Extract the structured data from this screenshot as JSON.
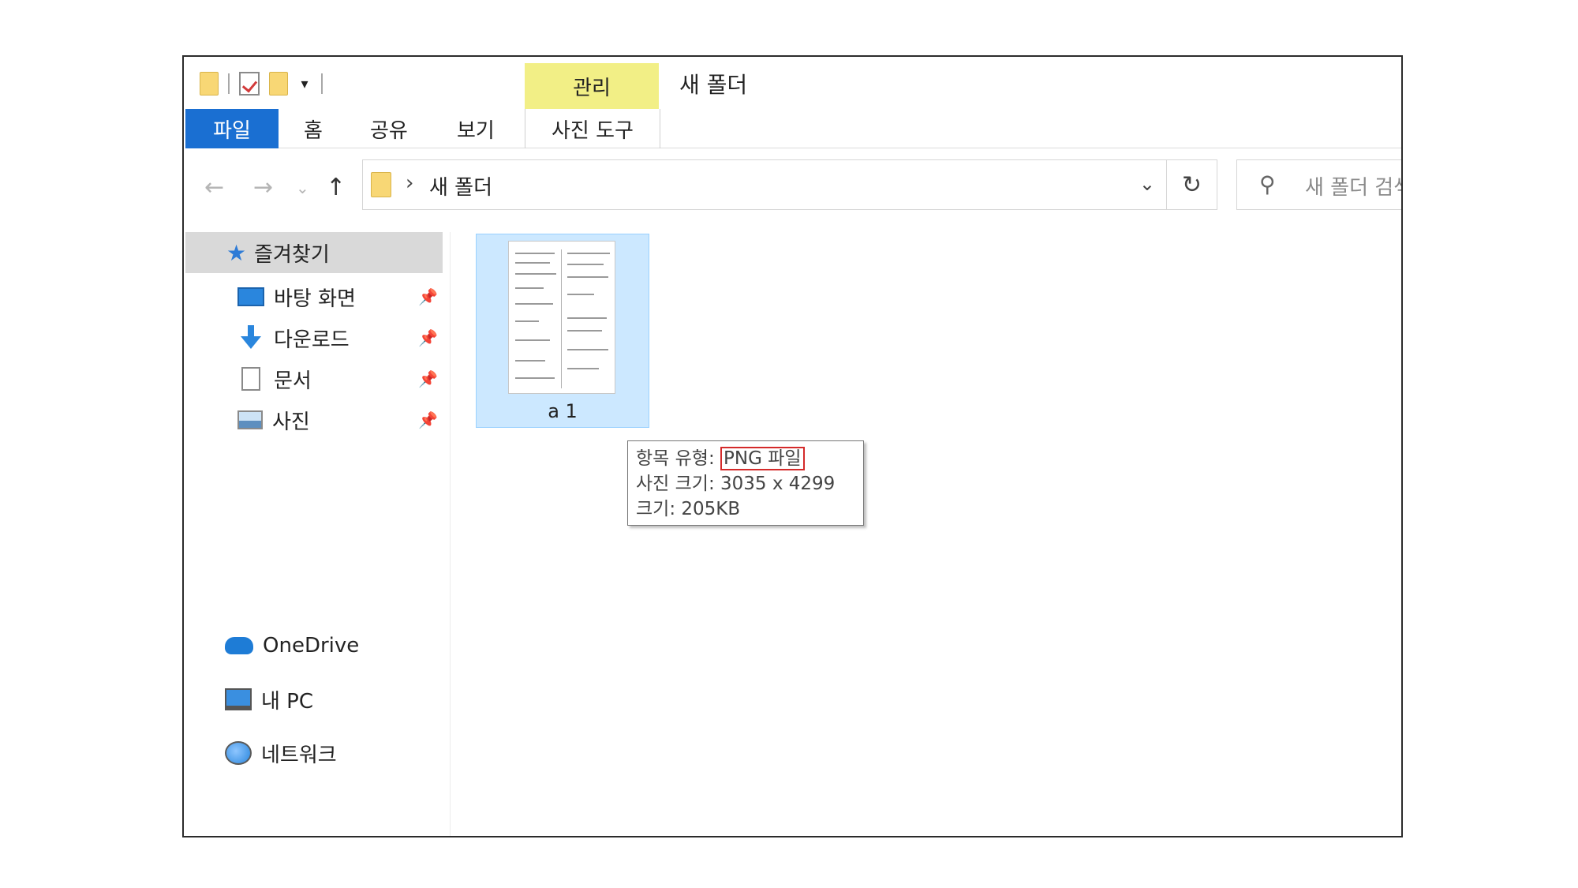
{
  "window": {
    "title": "새 폴더",
    "context_tab": "관리"
  },
  "ribbon": {
    "tabs": [
      {
        "label": "파일"
      },
      {
        "label": "홈"
      },
      {
        "label": "공유"
      },
      {
        "label": "보기"
      },
      {
        "label": "사진 도구"
      }
    ]
  },
  "address": {
    "path_label": "새 폴더",
    "search_placeholder": "새 폴더 검색"
  },
  "navigation": {
    "quick_access": "즐겨찾기",
    "pinned": [
      {
        "label": "바탕 화면",
        "icon": "desktop-icon"
      },
      {
        "label": "다운로드",
        "icon": "download-icon"
      },
      {
        "label": "문서",
        "icon": "documents-icon"
      },
      {
        "label": "사진",
        "icon": "pictures-icon"
      }
    ],
    "roots": [
      {
        "label": "OneDrive",
        "icon": "onedrive-icon"
      },
      {
        "label": "내 PC",
        "icon": "pc-icon"
      },
      {
        "label": "네트워크",
        "icon": "network-icon"
      }
    ]
  },
  "files": [
    {
      "name": "a 1",
      "selected": true
    }
  ],
  "tooltip": {
    "type_label": "항목 유형: ",
    "type_value": "PNG 파일",
    "dimensions": "사진 크기: 3035 x 4299",
    "size": "크기: 205KB"
  },
  "colors": {
    "file_tab_bg": "#1a6fd2",
    "manage_tab_bg": "#f2ef86",
    "selection_bg": "#cce8ff",
    "highlight_border": "#d42a2a"
  }
}
